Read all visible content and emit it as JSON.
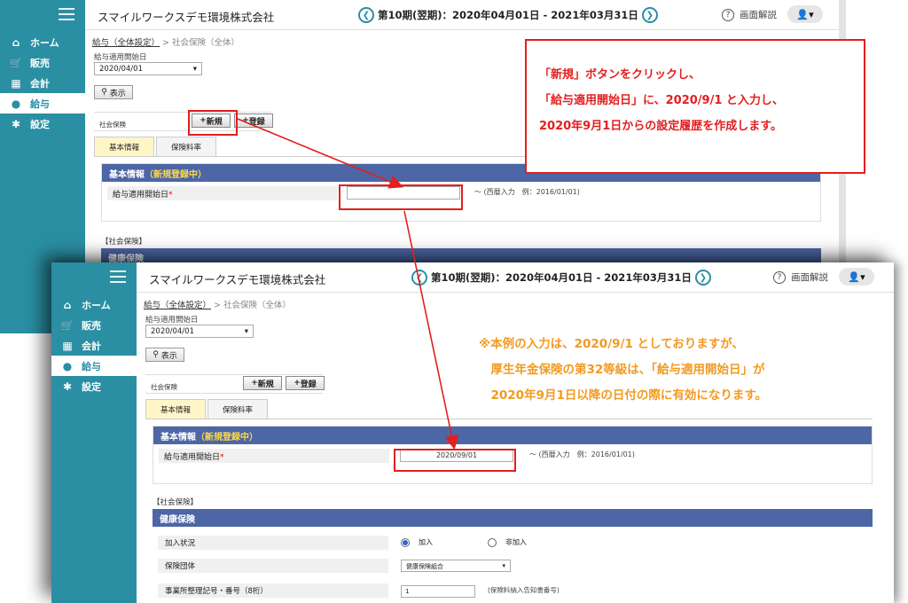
{
  "app": {
    "company": "スマイルワークスデモ環境株式会社",
    "period": "第10期(翌期)：2020年04月01日 - 2021年03月31日",
    "help_label": "画面解説",
    "user_icon": "user-icon"
  },
  "nav": {
    "items": [
      {
        "label": "ホーム",
        "icon": "home-icon"
      },
      {
        "label": "販売",
        "icon": "cart-icon"
      },
      {
        "label": "会計",
        "icon": "calculator-icon"
      },
      {
        "label": "給与",
        "icon": "money-bag-icon"
      },
      {
        "label": "設定",
        "icon": "gear-icon"
      }
    ],
    "active": "給与"
  },
  "breadcrumb": {
    "parent": "給与（全体設定）",
    "separator": ">",
    "current": "社会保険（全体）"
  },
  "filter": {
    "date_label": "給与適用開始日",
    "date_value": "2020/04/01",
    "show_button": "表示"
  },
  "section": {
    "label": "社会保険",
    "new_button": "新規",
    "register_button": "登録"
  },
  "tabs": [
    "基本情報",
    "保険料率"
  ],
  "basic_panel": {
    "title": "基本情報",
    "status": "（新規登録中）",
    "field_label": "給与適用開始日",
    "required_mark": "*",
    "value_before": "",
    "value_after": "2020/09/01",
    "hint": "～ (西暦入力　例：2016/01/01)"
  },
  "social_insurance": {
    "label": "【社会保険】",
    "health_title": "健康保険",
    "health_title_back": "健康保険",
    "rows": {
      "enrollment_label": "加入状況",
      "enrollment_options": [
        "加入",
        "非加入"
      ],
      "enrollment_selected": "加入",
      "group_label": "保険団体",
      "group_value": "健康保険組合",
      "office_label": "事業所整理記号・番号（8桁）",
      "office_value": "1",
      "office_hint": "(保険料納入告知書番号)"
    }
  },
  "callout": {
    "lines": [
      "「新規」ボタンをクリックし、",
      "「給与適用開始日」に、2020/9/1 と入力し、",
      "2020年9月1日からの設定履歴を作成します。"
    ]
  },
  "note": {
    "lines": [
      "※本例の入力は、2020/9/1 としておりますが、",
      "　厚生年金保険の第32等級は、「給与適用開始日」が",
      "　2020年9月1日以降の日付の際に有効になります。"
    ]
  },
  "colors": {
    "sidebar": "#2a8fa3",
    "panel_header": "#4d66a5",
    "annotation_red": "#e41e1e",
    "note_orange": "#f39a1f",
    "status_yellow": "#ffd84a"
  }
}
